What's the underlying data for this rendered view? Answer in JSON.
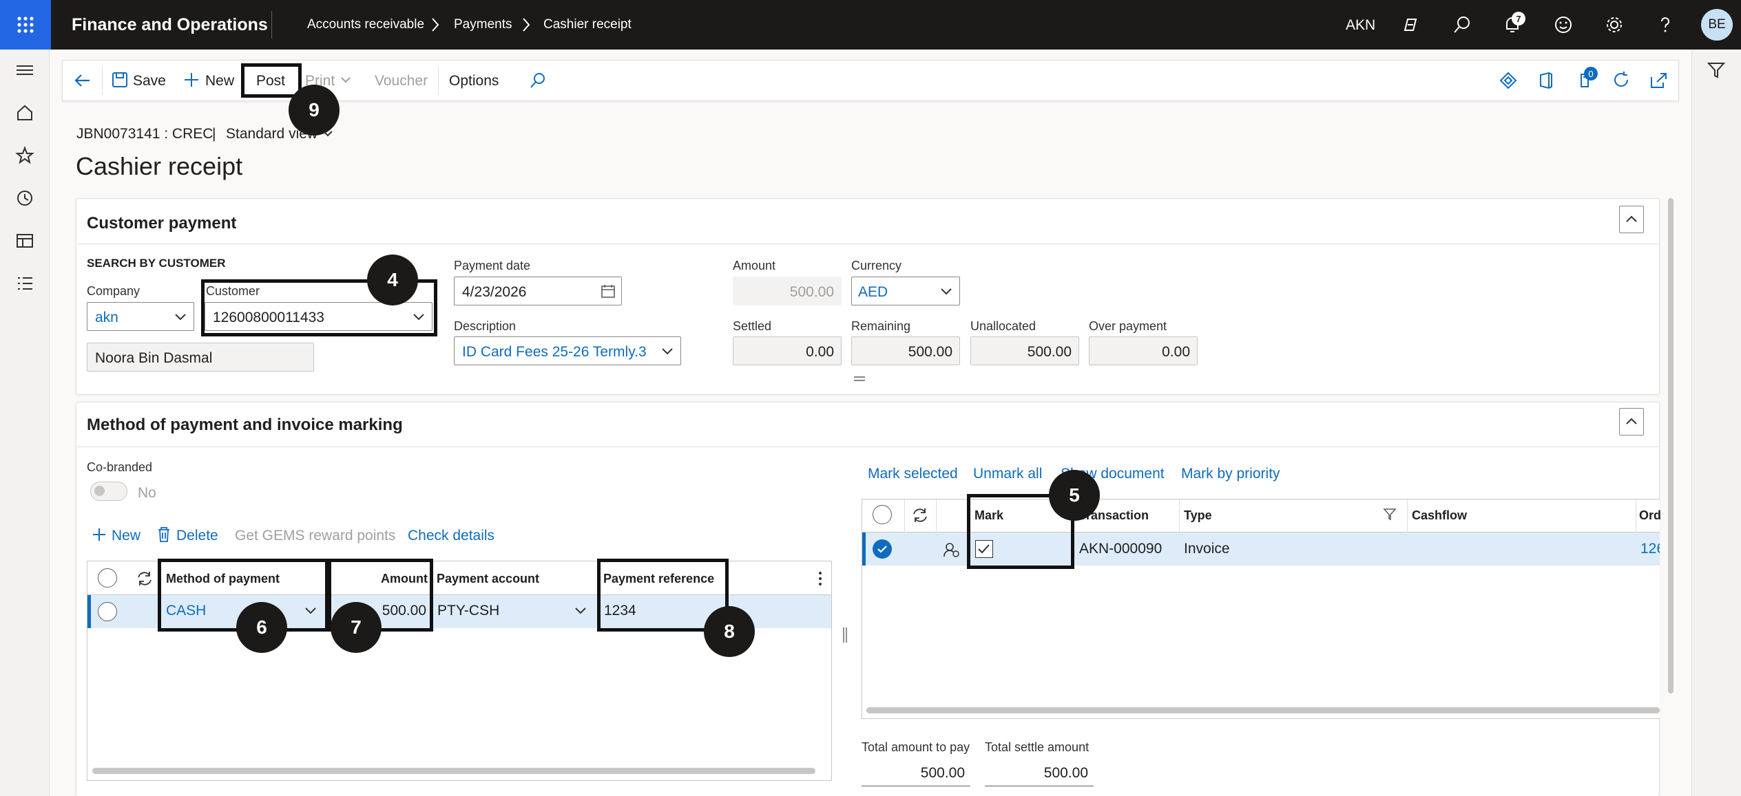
{
  "app": {
    "title": "Finance and Operations",
    "company": "AKN",
    "user_initials": "BE",
    "notification_count": "7"
  },
  "breadcrumb": [
    "Accounts receivable",
    "Payments",
    "Cashier receipt"
  ],
  "actionpane": {
    "save": "Save",
    "new": "New",
    "post": "Post",
    "print": "Print",
    "voucher": "Voucher",
    "options": "Options",
    "badge_count": "0"
  },
  "header": {
    "record": "JBN0073141 : CREC",
    "separator": "|",
    "view": "Standard view",
    "title": "Cashier receipt"
  },
  "customer_payment": {
    "title": "Customer payment",
    "search_title": "SEARCH BY CUSTOMER",
    "company_label": "Company",
    "company_value": "akn",
    "customer_label": "Customer",
    "customer_value": "12600800011433",
    "customer_name": "Noora Bin Dasmal",
    "payment_date_label": "Payment date",
    "payment_date_value": "4/23/2026",
    "description_label": "Description",
    "description_value": "ID Card Fees 25-26 Termly.3",
    "amount_label": "Amount",
    "amount_value": "500.00",
    "currency_label": "Currency",
    "currency_value": "AED",
    "settled_label": "Settled",
    "settled_value": "0.00",
    "remaining_label": "Remaining",
    "remaining_value": "500.00",
    "unallocated_label": "Unallocated",
    "unallocated_value": "500.00",
    "overpayment_label": "Over payment",
    "overpayment_value": "0.00"
  },
  "method_section": {
    "title": "Method of payment and invoice marking",
    "cobranded_label": "Co-branded",
    "cobranded_value": "No",
    "toolbar": {
      "new": "New",
      "delete": "Delete",
      "gems": "Get GEMS reward points",
      "check": "Check details"
    },
    "columns": [
      "Method of payment",
      "Amount",
      "Payment account",
      "Payment reference"
    ],
    "rows": [
      {
        "method": "CASH",
        "amount": "500.00",
        "account": "PTY-CSH",
        "reference": "1234"
      }
    ]
  },
  "invoice_panel": {
    "links": {
      "mark_selected": "Mark selected",
      "unmark_all": "Unmark all",
      "show_document": "Show document",
      "mark_priority": "Mark by priority"
    },
    "columns": {
      "mark": "Mark",
      "transaction": "Transaction",
      "type": "Type",
      "cashflow": "Cashflow",
      "order": "Ord"
    },
    "rows": [
      {
        "transaction": "AKN-000090",
        "type": "Invoice",
        "order": "126"
      }
    ],
    "totals": {
      "pay_label": "Total amount to pay",
      "pay_value": "500.00",
      "settle_label": "Total settle amount",
      "settle_value": "500.00"
    }
  },
  "callouts": {
    "c4": "4",
    "c5": "5",
    "c6": "6",
    "c7": "7",
    "c8": "8",
    "c9": "9"
  },
  "colors": {
    "topbar": "#1b1a19",
    "waffle": "#2266e3",
    "accent": "#0f6cbd",
    "selected_row": "#deecf9"
  }
}
